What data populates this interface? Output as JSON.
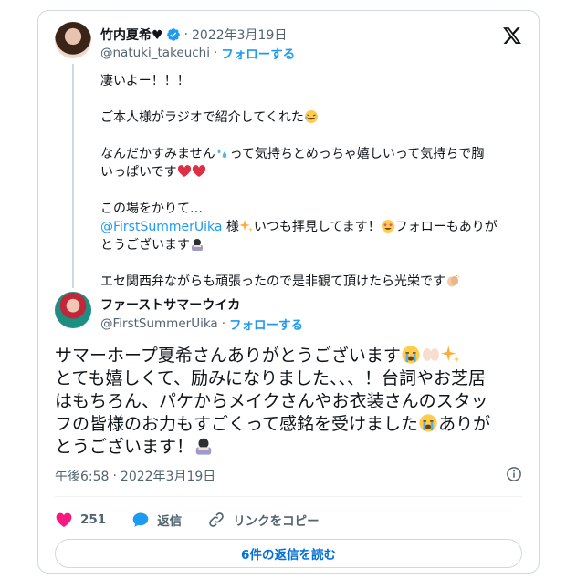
{
  "quoted_tweet": {
    "display_name": "竹内夏希♥",
    "date": "2022年3月19日",
    "handle": "@natuki_takeuchi",
    "follow_label": "フォローする",
    "lines": {
      "l1": "凄いよー！！！",
      "l2": "ご本人様がラジオで紹介してくれた",
      "l3a": "なんだかすみません",
      "l3b": "って気持ちとめっちゃ嬉しいって気持ちで胸",
      "l3c": "いっぱいです",
      "l4": "この場をかりて…",
      "mention": "@FirstSummerUika",
      "l5a": " 様",
      "l5b": "いつも拝見してます！",
      "l5c": "フォローもありが",
      "l5d": "とうございます",
      "l6": "エセ関西弁ながらも頑張ったので是非観て頂けたら光栄です"
    }
  },
  "main_tweet": {
    "display_name": "ファーストサマーウイカ",
    "handle": "@FirstSummerUika",
    "follow_label": "フォローする",
    "text": {
      "t1": "サマーホープ夏希さんありがとうございます",
      "t2": "とても嬉しくて、励みになりました、、、！台詞やお芝居",
      "t3": "はもちろん、パケからメイクさんやお衣装さんのスタッ",
      "t4": "フの皆様のお力もすごくって感銘を受けました",
      "t5": "ありが",
      "t6": "とうございます！"
    },
    "time": "午後6:58",
    "date": "2022年3月19日"
  },
  "actions": {
    "like_count": "251",
    "reply_label": "返信",
    "copy_link_label": "リンクをコピー"
  },
  "read_replies_label": "6件の返信を読む",
  "colors": {
    "accent": "#1d9bf0",
    "like": "#f91880",
    "muted": "#536471",
    "border": "#cfd9de"
  }
}
